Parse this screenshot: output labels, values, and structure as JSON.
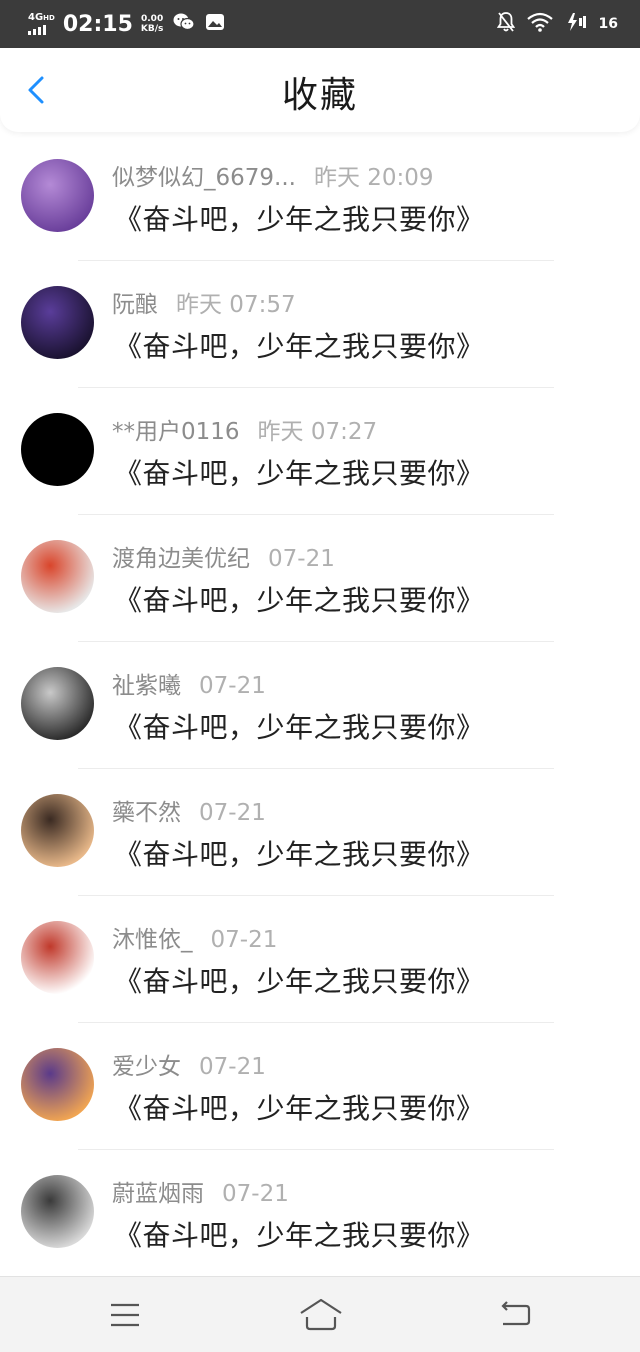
{
  "status_bar": {
    "network": "4G",
    "network_sup": "HD",
    "time": "02:15",
    "speed_value": "0.00",
    "speed_unit": "KB/s",
    "battery": "16",
    "icons": [
      "wechat-icon",
      "gallery-icon",
      "notification-off-icon",
      "wifi-icon",
      "charging-icon"
    ]
  },
  "header": {
    "title": "收藏",
    "back_icon": "chevron-left-icon"
  },
  "favorites": [
    {
      "user": "似梦似幻_6679...",
      "time": "昨天 20:09",
      "content": "《奋斗吧，少年之我只要你》",
      "avatar_colors": [
        "#6a3f9b",
        "#b48ad6"
      ]
    },
    {
      "user": "阮酿",
      "time": "昨天 07:57",
      "content": "《奋斗吧，少年之我只要你》",
      "avatar_colors": [
        "#1a1230",
        "#5a3d9a"
      ]
    },
    {
      "user": "**用户0116",
      "time": "昨天 07:27",
      "content": "《奋斗吧，少年之我只要你》",
      "avatar_colors": [
        "#000000",
        "#000000"
      ]
    },
    {
      "user": "渡角边美优纪",
      "time": "07-21",
      "content": "《奋斗吧，少年之我只要你》",
      "avatar_colors": [
        "#e8e8e8",
        "#d9452b"
      ]
    },
    {
      "user": "祉紫曦",
      "time": "07-21",
      "content": "《奋斗吧，少年之我只要你》",
      "avatar_colors": [
        "#2b2b2b",
        "#c9c9c9"
      ]
    },
    {
      "user": "藥不然",
      "time": "07-21",
      "content": "《奋斗吧，少年之我只要你》",
      "avatar_colors": [
        "#e9b98a",
        "#3a2a22"
      ]
    },
    {
      "user": "沐惟依_",
      "time": "07-21",
      "content": "《奋斗吧，少年之我只要你》",
      "avatar_colors": [
        "#ffffff",
        "#c0392b"
      ]
    },
    {
      "user": "爱少女",
      "time": "07-21",
      "content": "《奋斗吧，少年之我只要你》",
      "avatar_colors": [
        "#f1a552",
        "#5a3a8a"
      ]
    },
    {
      "user": "蔚蓝烟雨",
      "time": "07-21",
      "content": "《奋斗吧，少年之我只要你》",
      "avatar_colors": [
        "#d9d9d9",
        "#3a3a3a"
      ]
    }
  ],
  "nav_bar": {
    "icons": [
      "menu-icon",
      "home-icon",
      "back-icon"
    ]
  },
  "colors": {
    "accent": "#1e90ff",
    "status_bar_bg": "#3b3b3b"
  }
}
